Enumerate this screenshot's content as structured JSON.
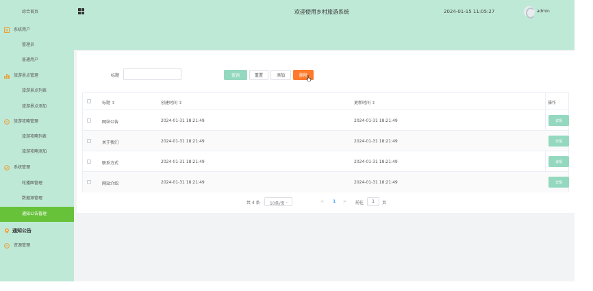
{
  "header": {
    "title": "欢迎使用乡村旅游系统",
    "datetime": "2024-01-15 11:05:27",
    "user": "admin"
  },
  "sidebar": {
    "items": [
      {
        "label": "综合首页"
      },
      {
        "label": "系统用户"
      },
      {
        "label": "管理员"
      },
      {
        "label": "普通用户"
      },
      {
        "label": "旅游景点管理"
      },
      {
        "label": "旅游景点列表"
      },
      {
        "label": "旅游景点添加"
      },
      {
        "label": "旅游攻略管理"
      },
      {
        "label": "旅游攻略列表"
      },
      {
        "label": "旅游攻略添加"
      },
      {
        "label": "系统管理"
      },
      {
        "label": "轮播图管理"
      },
      {
        "label": "数据源管理"
      },
      {
        "label": "通知公告管理"
      },
      {
        "label": "通知公告"
      },
      {
        "label": "资源管理"
      }
    ]
  },
  "search": {
    "title_label": "标题",
    "title_value": "",
    "buttons": {
      "search": "查询",
      "reset": "重置",
      "add": "添加",
      "delete": "删除"
    }
  },
  "table": {
    "columns": [
      "标题 ⇕",
      "创建时间 ⇕",
      "更新时间 ⇕",
      "操作"
    ],
    "rows": [
      {
        "title": "网站公告",
        "created": "2024-01-31 18:21:49",
        "updated": "2024-01-31 18:21:49",
        "action": "详情"
      },
      {
        "title": "关于我们",
        "created": "2024-01-31 18:21:49",
        "updated": "2024-01-31 18:21:49",
        "action": "详情"
      },
      {
        "title": "联系方式",
        "created": "2024-01-31 18:21:49",
        "updated": "2024-01-31 18:21:49",
        "action": "详情"
      },
      {
        "title": "网站介绍",
        "created": "2024-01-31 18:21:49",
        "updated": "2024-01-31 18:21:49",
        "action": "详情"
      }
    ]
  },
  "pagination": {
    "total": "共 4 条",
    "page_size": "10条/页",
    "prev": "<",
    "current": "1",
    "next": ">",
    "goto_label": "前往",
    "goto_value": "1",
    "page_unit": "页"
  },
  "colors": {
    "sidebar_bg": "#bfe9d7",
    "active_bg": "#67c23a",
    "delete_btn": "#ff7a2b",
    "search_btn": "#95d8c0"
  }
}
